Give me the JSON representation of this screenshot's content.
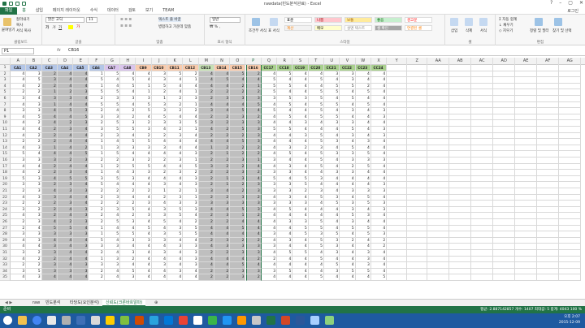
{
  "window": {
    "title": "rawdata(빈도분석완료) - Excel",
    "login": "로그인"
  },
  "menu": [
    "파일",
    "홈",
    "삽입",
    "페이지 레이아웃",
    "수식",
    "데이터",
    "검토",
    "보기",
    "TEAM"
  ],
  "ribbon": {
    "clipboard": {
      "label": "클립보드",
      "paste": "붙여넣기",
      "cut": "잘라내기",
      "copy": "복사",
      "format_painter": "서식 복사"
    },
    "font": {
      "label": "글꼴",
      "name": "맑은 고딕",
      "size": "11"
    },
    "align": {
      "label": "맞춤",
      "wrap": "텍스트 줄 바꿈",
      "merge": "병합하고 가운데 맞춤"
    },
    "number": {
      "label": "표시 형식",
      "format": "일반"
    },
    "styles": {
      "label": "스타일",
      "conditional": "조건부 서식",
      "table": "표 서식",
      "cells": [
        {
          "name": "표준",
          "bg": "#ffffff",
          "fg": "#000000"
        },
        {
          "name": "나쁨",
          "bg": "#ffc7ce",
          "fg": "#9c0006"
        },
        {
          "name": "보통",
          "bg": "#ffeb9c",
          "fg": "#9c5700"
        },
        {
          "name": "좋음",
          "bg": "#c6efce",
          "fg": "#006100"
        },
        {
          "name": "경고문",
          "bg": "#ffffff",
          "fg": "#ff0000"
        },
        {
          "name": "계산",
          "bg": "#f2f2f2",
          "fg": "#fa7d00"
        },
        {
          "name": "메모",
          "bg": "#ffffcc",
          "fg": "#000000"
        },
        {
          "name": "설명 텍스트",
          "bg": "#ffffff",
          "fg": "#7f7f7f"
        },
        {
          "name": "셀 확인",
          "bg": "#a5a5a5",
          "fg": "#ffffff"
        },
        {
          "name": "연결된 셀",
          "bg": "#ffffff",
          "fg": "#fa7d00"
        }
      ]
    },
    "cells": {
      "label": "셀",
      "insert": "삽입",
      "delete": "삭제",
      "format": "서식"
    },
    "editing": {
      "label": "편집",
      "autosum": "자동 합계",
      "fill": "채우기",
      "clear": "지우기",
      "sort": "정렬 및 필터",
      "find": "찾기 및 선택"
    }
  },
  "formula_bar": {
    "namebox": "P1",
    "fx": "fx",
    "value": "CB16"
  },
  "sheet": {
    "col_letters": [
      "A",
      "B",
      "C",
      "D",
      "E",
      "F",
      "G",
      "H",
      "I",
      "J",
      "K",
      "L",
      "M",
      "N",
      "O",
      "P",
      "Q",
      "R",
      "S",
      "T",
      "U",
      "V",
      "W",
      "X",
      "Y",
      "Z",
      "AA",
      "AB",
      "AC",
      "AD",
      "AE",
      "AF",
      "AG"
    ],
    "headers": [
      "CA1",
      "CA2",
      "CA3",
      "CA4",
      "CA5",
      "CA6",
      "CA7",
      "CA8",
      "CB9",
      "CB10",
      "CB11",
      "CB12",
      "CB13",
      "CB14",
      "CB15",
      "CB16",
      "CC17",
      "CC18",
      "CC19",
      "CC20",
      "CC21",
      "CC22",
      "CC23",
      "CC24"
    ],
    "header_colors": [
      "#b4c6e7",
      "#b4c6e7",
      "#b4c6e7",
      "#b4c6e7",
      "#b4c6e7",
      "#b4c6e7",
      "#d9c4ec",
      "#d9c4ec",
      "#f8cbad",
      "#f8cbad",
      "#f8cbad",
      "#f8cbad",
      "#c6e0b4",
      "#f8cbad",
      "#f8cbad",
      "#f8cbad",
      "#a9d08e",
      "#a9d08e",
      "#a9d08e",
      "#a9d08e",
      "#a9d08e",
      "#a9d08e",
      "#a9d08e",
      "#a9d08e"
    ],
    "gray_cols": [
      2,
      3,
      4,
      12,
      13,
      14,
      15
    ],
    "rows": [
      [
        4,
        3,
        2,
        4,
        4,
        1,
        5,
        4,
        4,
        3,
        5,
        2,
        4,
        4,
        5,
        2,
        4,
        5,
        4,
        4,
        3,
        3,
        4,
        4
      ],
      [
        4,
        5,
        3,
        4,
        4,
        5,
        4,
        5,
        4,
        3,
        4,
        1,
        4,
        5,
        4,
        4,
        5,
        4,
        4,
        5,
        4,
        3,
        4,
        4
      ],
      [
        4,
        2,
        2,
        4,
        4,
        1,
        4,
        5,
        1,
        5,
        4,
        4,
        4,
        4,
        2,
        1,
        5,
        5,
        4,
        4,
        5,
        5,
        2,
        4
      ],
      [
        2,
        2,
        1,
        2,
        3,
        5,
        5,
        4,
        1,
        2,
        4,
        1,
        2,
        2,
        2,
        2,
        5,
        4,
        4,
        5,
        5,
        4,
        5,
        4
      ],
      [
        3,
        4,
        3,
        3,
        4,
        2,
        3,
        3,
        3,
        1,
        2,
        3,
        2,
        3,
        3,
        3,
        3,
        5,
        3,
        5,
        4,
        5,
        4,
        4
      ],
      [
        4,
        3,
        1,
        4,
        4,
        5,
        5,
        4,
        5,
        3,
        2,
        1,
        4,
        4,
        4,
        5,
        4,
        5,
        4,
        5,
        5,
        4,
        5,
        4
      ],
      [
        3,
        3,
        4,
        5,
        3,
        2,
        4,
        2,
        5,
        3,
        2,
        2,
        3,
        4,
        5,
        4,
        5,
        4,
        4,
        5,
        4,
        3,
        4,
        3
      ],
      [
        4,
        5,
        4,
        4,
        5,
        3,
        3,
        2,
        4,
        5,
        4,
        4,
        2,
        2,
        3,
        2,
        4,
        5,
        4,
        5,
        5,
        4,
        4,
        3
      ],
      [
        4,
        2,
        4,
        2,
        3,
        2,
        5,
        3,
        2,
        3,
        3,
        5,
        3,
        2,
        3,
        3,
        4,
        4,
        3,
        4,
        3,
        3,
        4,
        4
      ],
      [
        4,
        4,
        2,
        3,
        4,
        3,
        5,
        5,
        3,
        4,
        2,
        1,
        4,
        2,
        5,
        3,
        5,
        5,
        4,
        4,
        4,
        5,
        4,
        3
      ],
      [
        4,
        2,
        2,
        4,
        4,
        2,
        3,
        4,
        2,
        2,
        3,
        4,
        2,
        2,
        2,
        3,
        4,
        4,
        3,
        5,
        4,
        3,
        4,
        3
      ],
      [
        2,
        2,
        2,
        4,
        4,
        1,
        4,
        5,
        5,
        4,
        4,
        4,
        4,
        4,
        5,
        3,
        4,
        4,
        4,
        5,
        3,
        4,
        3,
        4
      ],
      [
        4,
        3,
        1,
        4,
        2,
        1,
        3,
        3,
        3,
        3,
        4,
        4,
        1,
        2,
        2,
        2,
        4,
        3,
        2,
        3,
        4,
        5,
        4,
        4
      ],
      [
        5,
        4,
        4,
        4,
        5,
        1,
        5,
        4,
        4,
        4,
        4,
        3,
        2,
        1,
        2,
        2,
        4,
        5,
        4,
        5,
        3,
        3,
        5,
        4
      ],
      [
        3,
        3,
        3,
        2,
        3,
        2,
        2,
        3,
        2,
        2,
        3,
        1,
        2,
        2,
        3,
        1,
        3,
        4,
        4,
        5,
        4,
        3,
        3,
        3
      ],
      [
        4,
        4,
        2,
        4,
        4,
        1,
        2,
        5,
        5,
        4,
        4,
        5,
        3,
        2,
        2,
        4,
        4,
        3,
        4,
        5,
        4,
        2,
        5,
        4
      ],
      [
        4,
        2,
        2,
        3,
        4,
        1,
        4,
        3,
        3,
        2,
        3,
        2,
        2,
        2,
        3,
        2,
        3,
        3,
        4,
        4,
        3,
        3,
        4,
        4
      ],
      [
        5,
        3,
        4,
        5,
        5,
        3,
        5,
        3,
        4,
        4,
        4,
        3,
        2,
        1,
        3,
        4,
        5,
        4,
        5,
        3,
        4,
        4,
        4,
        4
      ],
      [
        3,
        3,
        2,
        3,
        4,
        5,
        4,
        4,
        4,
        3,
        4,
        3,
        2,
        1,
        2,
        3,
        3,
        3,
        5,
        4,
        4,
        4,
        4,
        3
      ],
      [
        2,
        3,
        4,
        3,
        3,
        2,
        2,
        2,
        2,
        1,
        2,
        1,
        3,
        4,
        2,
        3,
        3,
        3,
        2,
        3,
        4,
        3,
        3,
        3
      ],
      [
        4,
        3,
        3,
        4,
        4,
        2,
        3,
        4,
        4,
        2,
        3,
        1,
        2,
        2,
        3,
        2,
        4,
        3,
        4,
        5,
        3,
        4,
        5,
        4
      ],
      [
        2,
        2,
        2,
        3,
        4,
        2,
        2,
        2,
        3,
        4,
        3,
        3,
        3,
        3,
        3,
        3,
        3,
        3,
        3,
        4,
        5,
        3,
        5,
        3
      ],
      [
        3,
        2,
        2,
        4,
        3,
        2,
        3,
        5,
        4,
        3,
        5,
        3,
        4,
        4,
        5,
        3,
        4,
        5,
        4,
        4,
        4,
        3,
        4,
        3
      ],
      [
        4,
        3,
        2,
        4,
        3,
        2,
        4,
        2,
        3,
        3,
        5,
        4,
        2,
        3,
        1,
        2,
        4,
        4,
        4,
        4,
        4,
        5,
        3,
        4
      ],
      [
        2,
        3,
        4,
        2,
        3,
        2,
        5,
        3,
        4,
        5,
        4,
        2,
        2,
        2,
        4,
        4,
        4,
        3,
        3,
        5,
        4,
        3,
        4,
        4
      ],
      [
        2,
        4,
        5,
        5,
        4,
        1,
        4,
        4,
        5,
        4,
        3,
        5,
        4,
        4,
        5,
        4,
        4,
        4,
        5,
        5,
        4,
        5,
        5,
        4
      ],
      [
        3,
        3,
        3,
        3,
        3,
        1,
        5,
        5,
        4,
        3,
        5,
        5,
        4,
        4,
        4,
        4,
        3,
        4,
        5,
        3,
        5,
        4,
        5,
        3
      ],
      [
        4,
        3,
        4,
        4,
        4,
        5,
        4,
        3,
        3,
        3,
        4,
        4,
        2,
        3,
        2,
        2,
        4,
        3,
        4,
        5,
        3,
        2,
        4,
        2
      ],
      [
        4,
        4,
        3,
        4,
        3,
        3,
        3,
        4,
        4,
        4,
        3,
        3,
        4,
        3,
        3,
        3,
        3,
        4,
        4,
        5,
        3,
        4,
        4,
        2
      ],
      [
        3,
        2,
        3,
        4,
        4,
        2,
        4,
        3,
        4,
        3,
        4,
        3,
        2,
        2,
        3,
        3,
        4,
        5,
        5,
        4,
        3,
        4,
        3,
        4
      ],
      [
        4,
        2,
        2,
        4,
        4,
        1,
        3,
        2,
        4,
        4,
        4,
        3,
        4,
        4,
        4,
        2,
        2,
        4,
        4,
        5,
        4,
        4,
        3,
        4
      ],
      [
        2,
        2,
        3,
        4,
        3,
        3,
        3,
        4,
        4,
        3,
        4,
        3,
        4,
        4,
        5,
        4,
        4,
        4,
        4,
        4,
        5,
        4,
        3,
        4
      ],
      [
        3,
        5,
        3,
        3,
        3,
        2,
        4,
        5,
        4,
        4,
        3,
        4,
        2,
        2,
        3,
        3,
        3,
        5,
        4,
        4,
        3,
        5,
        5,
        4
      ],
      [
        4,
        3,
        4,
        4,
        4,
        2,
        4,
        3,
        4,
        4,
        4,
        4,
        2,
        2,
        3,
        2,
        4,
        4,
        4,
        5,
        4,
        4,
        4,
        5
      ]
    ]
  },
  "sheet_tabs": [
    "raw",
    "빈도분석",
    "타당도(요인분석)",
    "신뢰도(크론바흐알파)"
  ],
  "active_tab": 3,
  "status": {
    "left": "준비",
    "right": "평균: 2.887142857   개수: 1407   최대값: 5   합계: 4043",
    "zoom": "100 %"
  },
  "taskbar": {
    "time": "오후 2:07",
    "date": "2015-12-09"
  }
}
